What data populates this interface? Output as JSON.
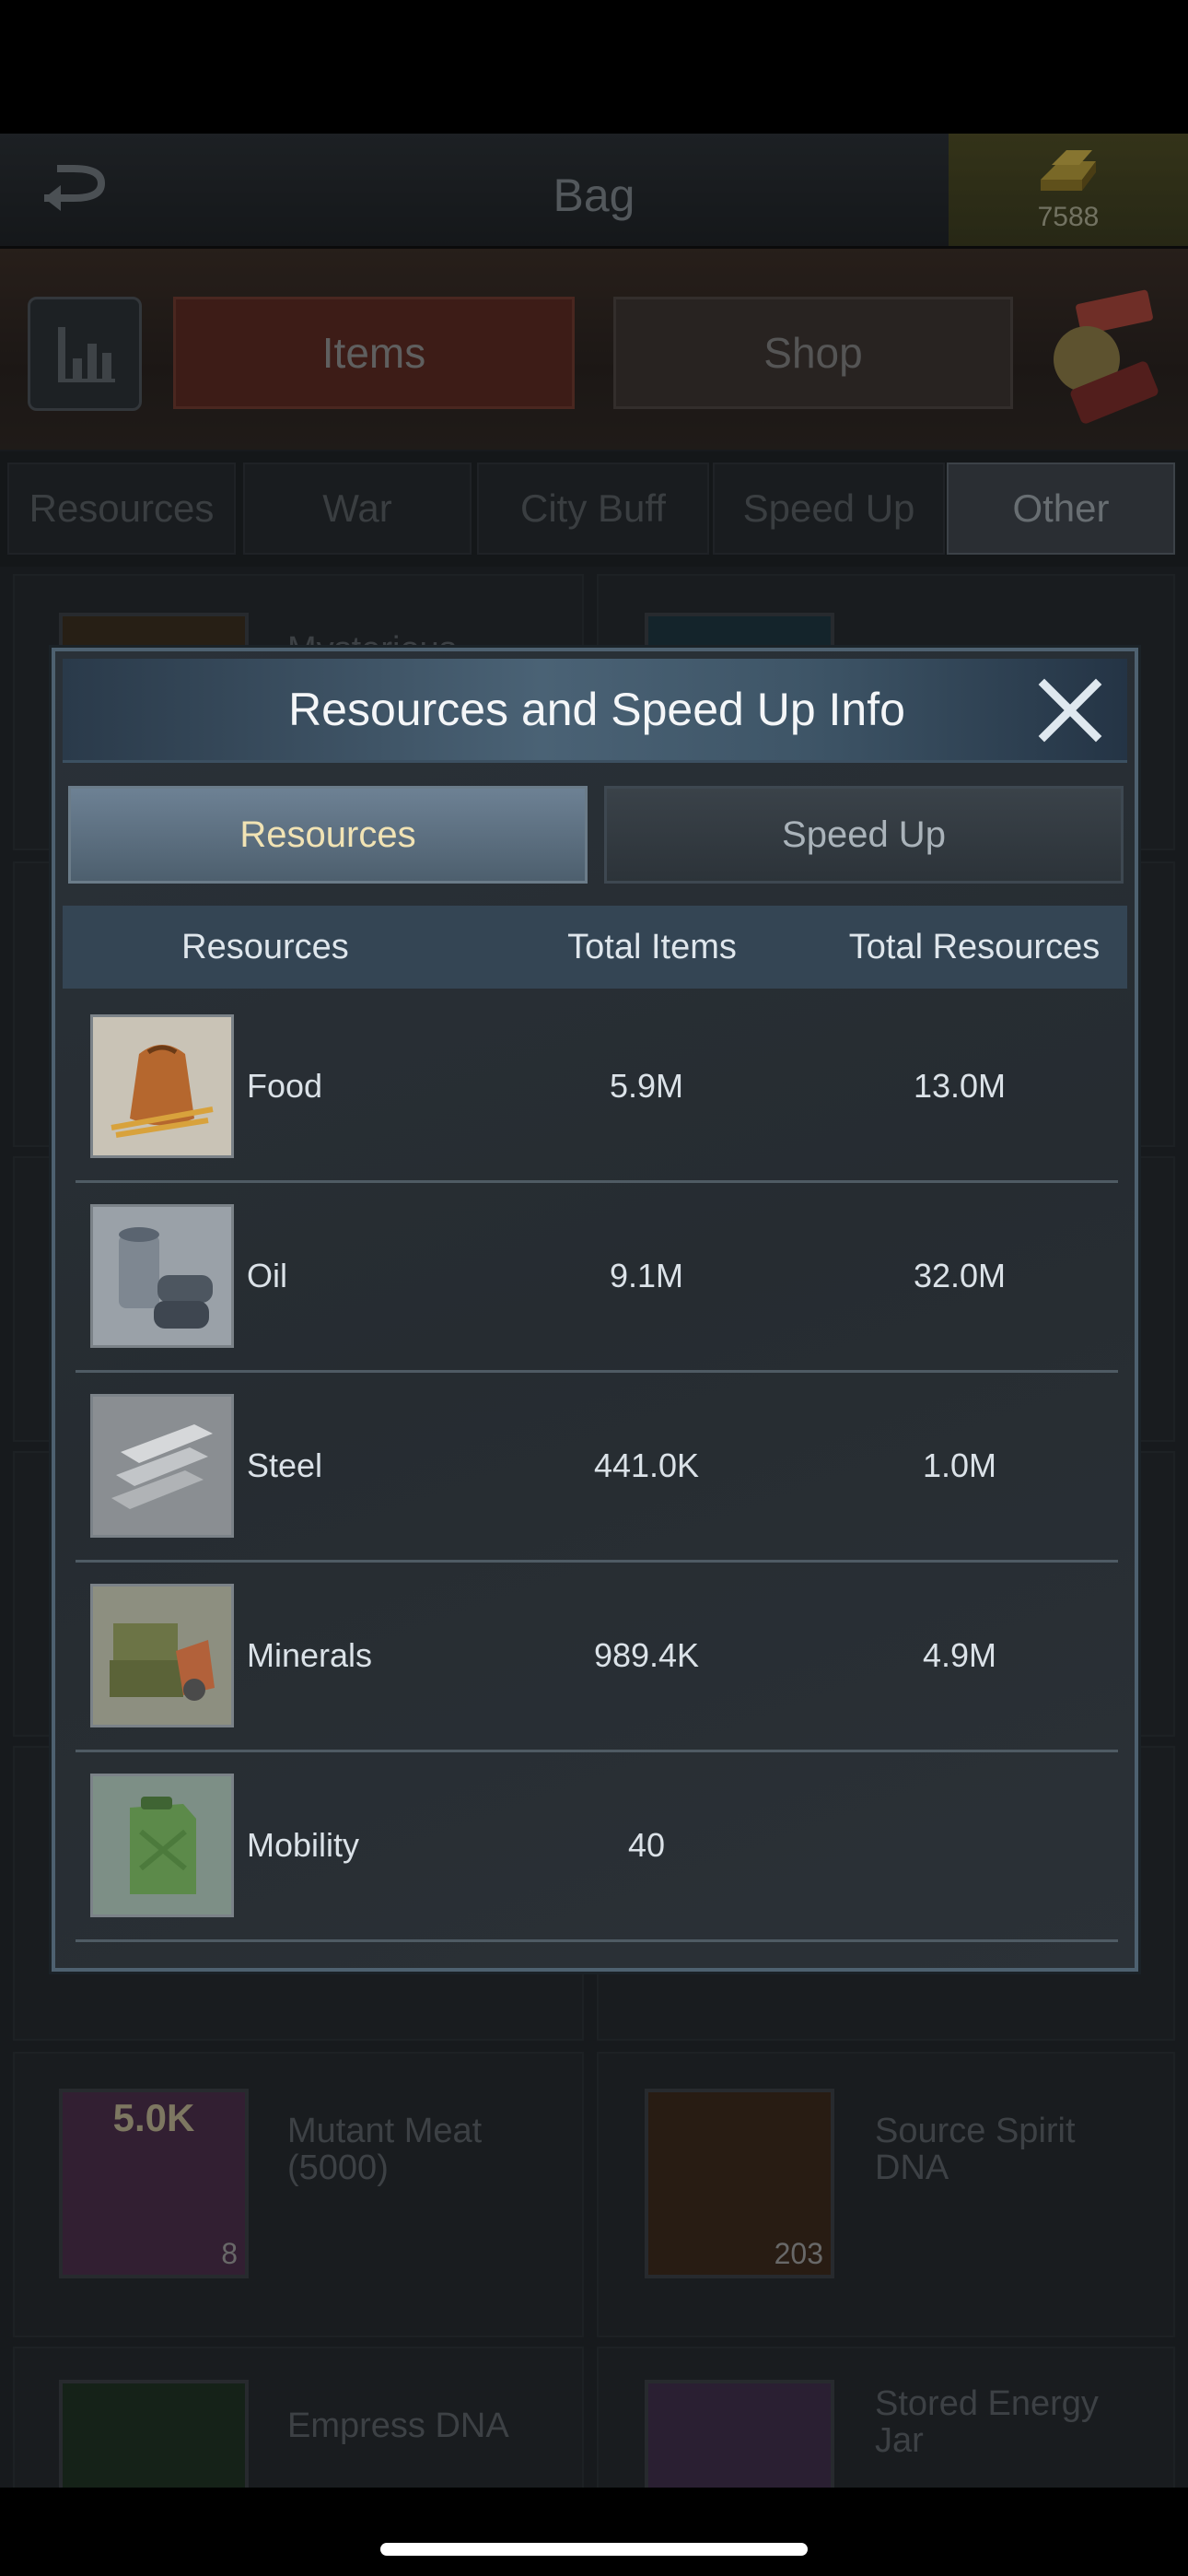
{
  "header": {
    "title": "Bag",
    "gold_count": "7588"
  },
  "main_tabs": {
    "items": "Items",
    "shop": "Shop"
  },
  "categories": [
    "Resources",
    "War",
    "City Buff",
    "Speed Up",
    "Other"
  ],
  "background_items": [
    {
      "name": "Mysterious",
      "count": ""
    },
    {
      "name": "Mutant Meat (5000)",
      "count": "8",
      "thumb_label": "5.0K"
    },
    {
      "name": "Source Spirit DNA",
      "count": "203"
    },
    {
      "name": "Empress DNA",
      "count": ""
    },
    {
      "name": "Stored Energy Jar",
      "count": ""
    }
  ],
  "modal": {
    "title": "Resources and Speed Up Info",
    "tabs": {
      "resources": "Resources",
      "speed_up": "Speed Up"
    },
    "columns": [
      "Resources",
      "Total Items",
      "Total Resources"
    ],
    "rows": [
      {
        "name": "Food",
        "total_items": "5.9M",
        "total_resources": "13.0M",
        "icon": "food-sack-icon"
      },
      {
        "name": "Oil",
        "total_items": "9.1M",
        "total_resources": "32.0M",
        "icon": "oil-barrel-icon"
      },
      {
        "name": "Steel",
        "total_items": "441.0K",
        "total_resources": "1.0M",
        "icon": "steel-beams-icon"
      },
      {
        "name": "Minerals",
        "total_items": "989.4K",
        "total_resources": "4.9M",
        "icon": "minerals-crate-icon"
      },
      {
        "name": "Mobility",
        "total_items": "40",
        "total_resources": "",
        "icon": "jerrycan-icon"
      }
    ]
  },
  "colors": {
    "accent_active_tab_text": "#f1e3b4",
    "items_tab_bg": "#5a2a23"
  }
}
